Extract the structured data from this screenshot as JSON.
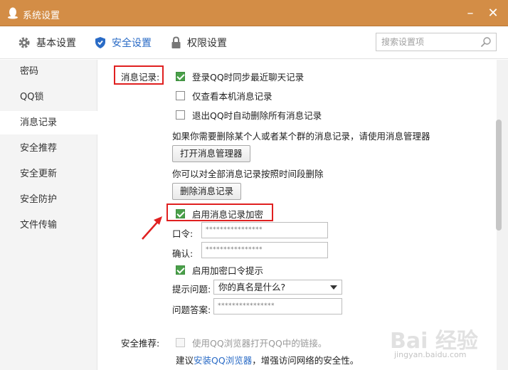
{
  "window": {
    "title": "系统设置",
    "minimize_icon": "minimize-icon",
    "close_icon": "close-icon"
  },
  "toolbar": {
    "tabs": [
      {
        "label": "基本设置",
        "icon": "gear-icon"
      },
      {
        "label": "安全设置",
        "icon": "shield-icon",
        "active": true
      },
      {
        "label": "权限设置",
        "icon": "lock-icon"
      }
    ],
    "search_placeholder": "搜索设置项"
  },
  "sidebar": {
    "items": [
      {
        "label": "密码"
      },
      {
        "label": "QQ锁"
      },
      {
        "label": "消息记录",
        "active": true
      },
      {
        "label": "安全推荐"
      },
      {
        "label": "安全更新"
      },
      {
        "label": "安全防护"
      },
      {
        "label": "文件传输"
      }
    ]
  },
  "message_record": {
    "section_label": "消息记录:",
    "options": [
      {
        "label": "登录QQ时同步最近聊天记录",
        "checked": true
      },
      {
        "label": "仅查看本机消息记录",
        "checked": false
      },
      {
        "label": "退出QQ时自动删除所有消息记录",
        "checked": false
      }
    ],
    "manager_hint": "如果你需要删除某个人或者某个群的消息记录，请使用消息管理器",
    "open_manager_button": "打开消息管理器",
    "delete_hint": "你可以对全部消息记录按照时间段删除",
    "delete_button": "删除消息记录",
    "encrypt_label": "启用消息记录加密",
    "encrypt_checked": true,
    "password_label": "口令:",
    "password_value": "****************",
    "confirm_label": "确认:",
    "confirm_value": "****************",
    "hint_enable_label": "启用加密口令提示",
    "hint_enable_checked": true,
    "question_label": "提示问题:",
    "question_value": "你的真名是什么?",
    "answer_label": "问题答案:",
    "answer_value": "****************"
  },
  "security_recommend": {
    "section_label": "安全推荐:",
    "option_label": "使用QQ浏览器打开QQ中的链接。",
    "option_checked": false,
    "advice_prefix": "建议",
    "advice_link": "安装QQ浏览器",
    "advice_suffix": "，增强访问网络的安全性。"
  },
  "watermark": {
    "text": "Bai 经验",
    "url": "jingyan.baidu.com"
  },
  "colors": {
    "title_bar": "#d38d46",
    "accent": "#2a6bc6",
    "check": "#4aa04a",
    "highlight": "#e02020"
  }
}
